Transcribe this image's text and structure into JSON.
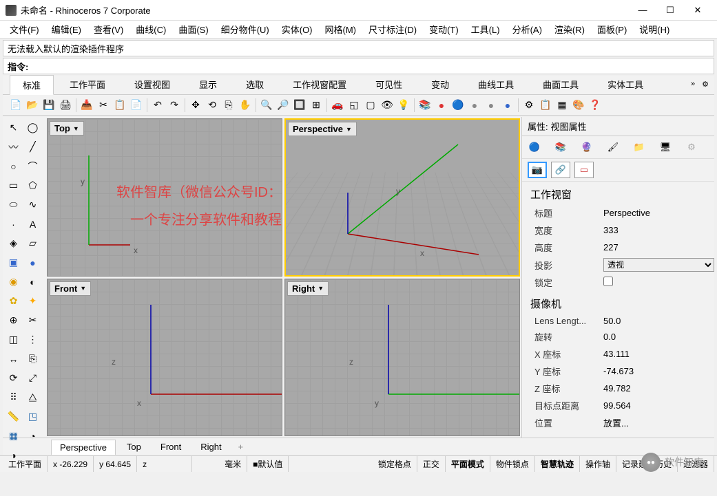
{
  "titlebar": {
    "title": "未命名 - Rhinoceros 7 Corporate"
  },
  "menus": [
    "文件(F)",
    "编辑(E)",
    "查看(V)",
    "曲线(C)",
    "曲面(S)",
    "细分物件(U)",
    "实体(O)",
    "网格(M)",
    "尺寸标注(D)",
    "变动(T)",
    "工具(L)",
    "分析(A)",
    "渲染(R)",
    "面板(P)",
    "说明(H)"
  ],
  "msg": "无法载入默认的渲染插件程序",
  "cmdlabel": "指令:",
  "tabs": [
    "标准",
    "工作平面",
    "设置视图",
    "显示",
    "选取",
    "工作视窗配置",
    "可见性",
    "变动",
    "曲线工具",
    "曲面工具",
    "实体工具"
  ],
  "viewports": {
    "tl": "Top",
    "tr": "Perspective",
    "bl": "Front",
    "br": "Right",
    "axis_tl": [
      "x",
      "y"
    ],
    "axis_tr": [
      "x",
      "y"
    ],
    "axis_bl": [
      "x",
      "z"
    ],
    "axis_br": [
      "y",
      "z"
    ]
  },
  "watermark": {
    "line1": "软件智库（微信公众号ID：rjzkgzh）",
    "line2": "一个专注分享软件和教程的公众号！"
  },
  "panel": {
    "header_label": "属性:",
    "header_value": "视图属性",
    "sect1": "工作视窗",
    "rows1": [
      {
        "l": "标题",
        "v": "Perspective"
      },
      {
        "l": "宽度",
        "v": "333"
      },
      {
        "l": "高度",
        "v": "227"
      }
    ],
    "proj_label": "投影",
    "proj_value": "透视",
    "lock_label": "锁定",
    "sect2": "摄像机",
    "rows2": [
      {
        "l": "Lens Lengt...",
        "v": "50.0"
      },
      {
        "l": "旋转",
        "v": "0.0"
      },
      {
        "l": "X 座标",
        "v": "43.111"
      },
      {
        "l": "Y 座标",
        "v": "-74.673"
      },
      {
        "l": "Z 座标",
        "v": "49.782"
      },
      {
        "l": "目标点距离",
        "v": "99.564"
      },
      {
        "l": "位置",
        "v": "放置..."
      }
    ]
  },
  "vtabs": [
    "Perspective",
    "Top",
    "Front",
    "Right"
  ],
  "status": {
    "layer": "工作平面",
    "x": "x -26.229",
    "y": "y 64.645",
    "z": "z",
    "unit": "毫米",
    "default": "默认值",
    "right": [
      "锁定格点",
      "正交",
      "平面模式",
      "物件锁点",
      "智慧轨迹",
      "操作轴",
      "记录建构历史",
      "过滤器"
    ]
  },
  "wm_brand": "软件智库"
}
